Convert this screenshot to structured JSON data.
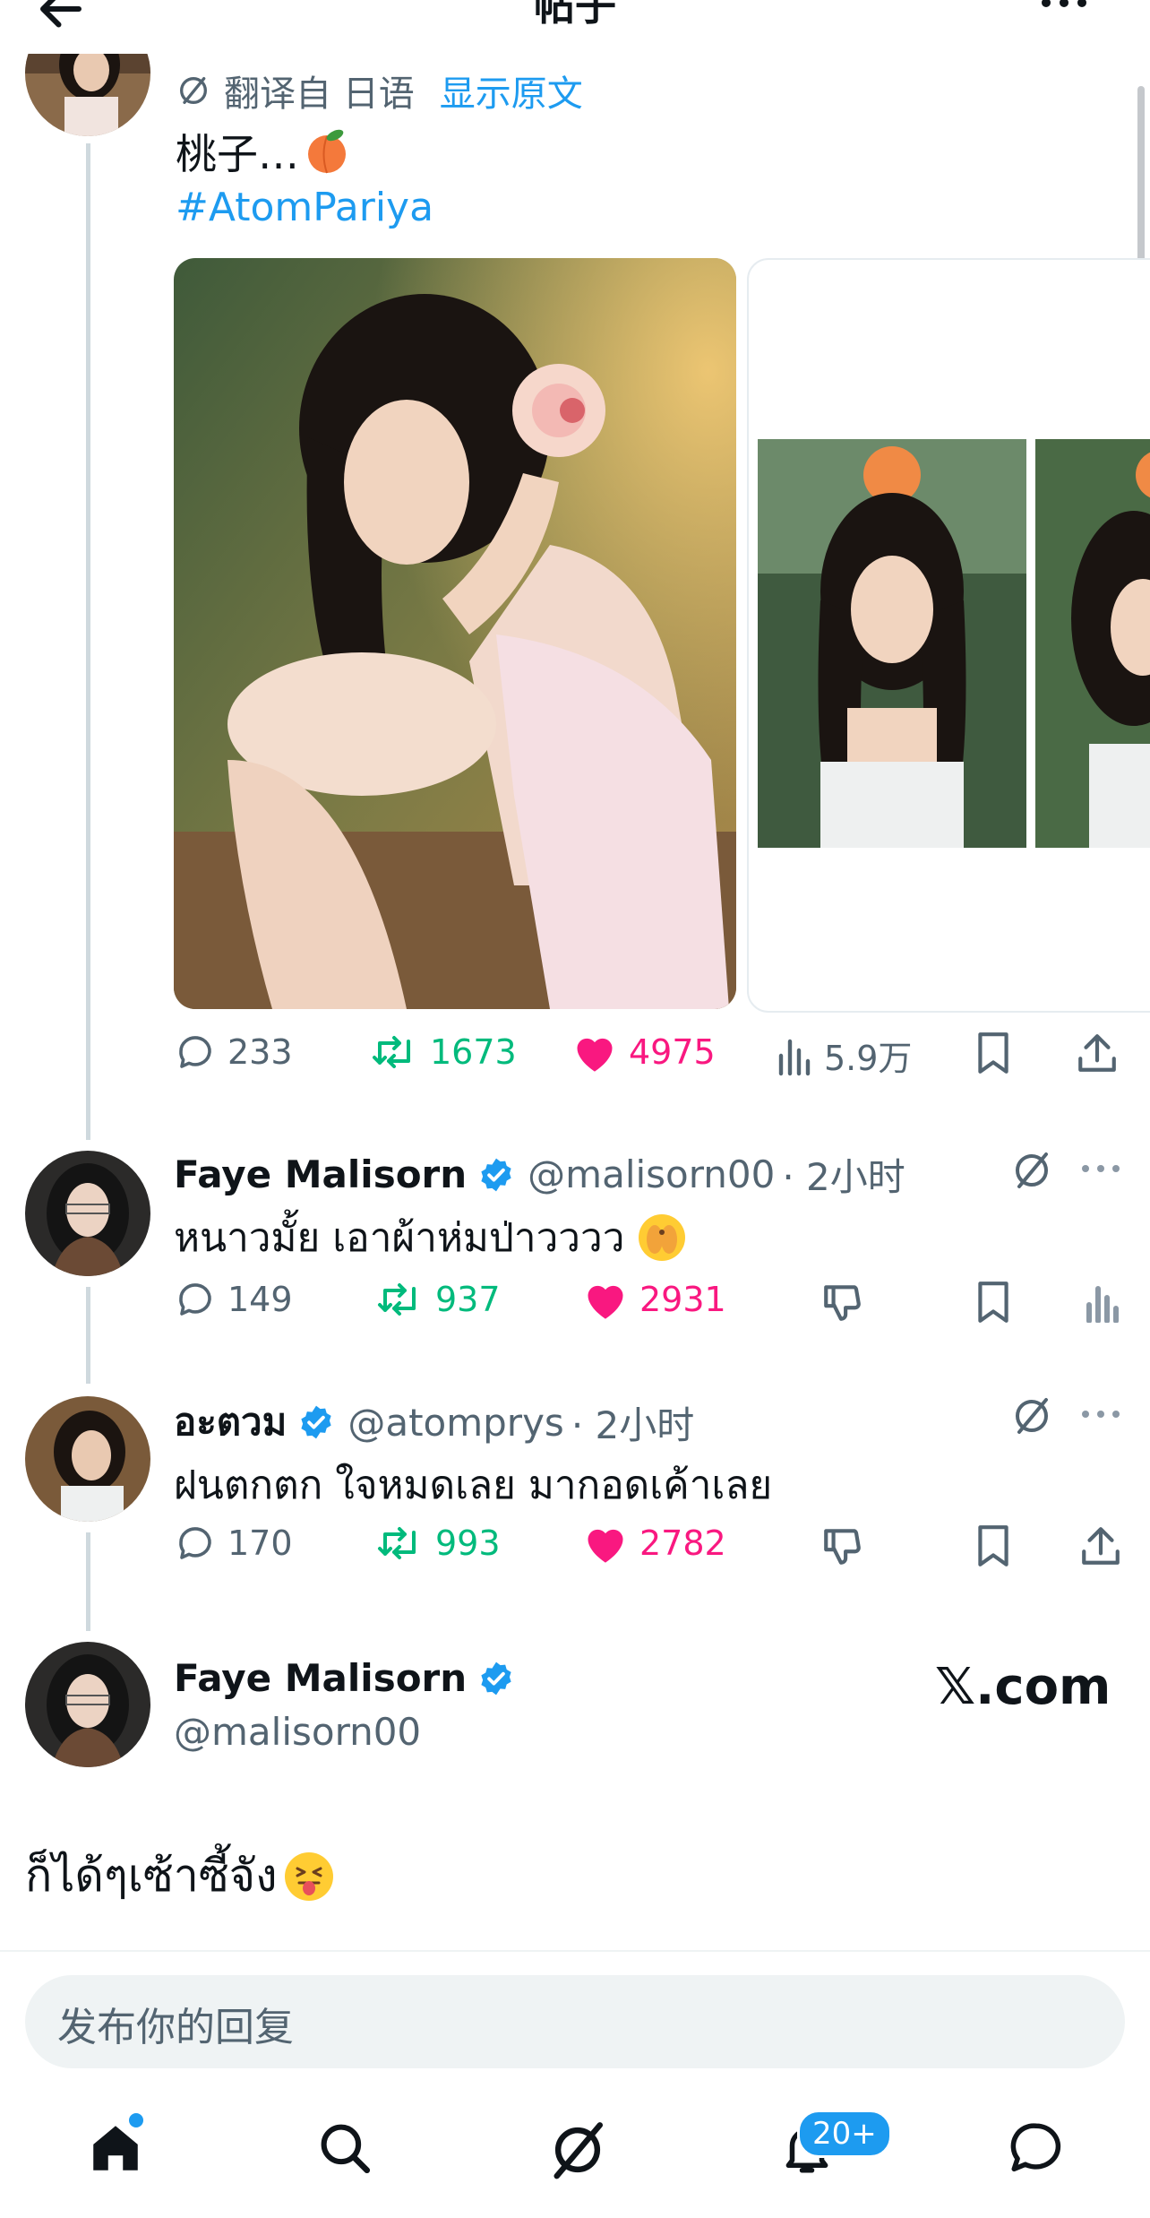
{
  "header": {
    "title": "帖子"
  },
  "main_post": {
    "translate_label": "翻译自 日语",
    "show_original": "显示原文",
    "text": "桃子…",
    "hashtag": "#AtomPariya",
    "stats": {
      "replies": "233",
      "reposts": "1673",
      "likes": "4975",
      "views": "5.9万"
    }
  },
  "replies": [
    {
      "name": "Faye Malisorn",
      "handle": "@malisorn00",
      "time": "· 2小时",
      "text": "หนาวมั้ย เอาผ้าห่มป่าวววว",
      "stats": {
        "replies": "149",
        "reposts": "937",
        "likes": "2931"
      }
    },
    {
      "name": "อะตวม",
      "handle": "@atomprys",
      "time": "· 2小时",
      "text": "ฝนตกตก ใจหมดเลย มากอดเค้าเลย",
      "stats": {
        "replies": "170",
        "reposts": "993",
        "likes": "2782"
      }
    }
  ],
  "focused": {
    "name": "Faye Malisorn",
    "handle": "@malisorn00",
    "watermark": "𝕏.com",
    "text": "ก็ได้ๆเซ้าซี้จัง"
  },
  "reply_input": {
    "placeholder": "发布你的回复"
  },
  "bottom_nav": {
    "notifications_badge": "20+"
  },
  "colors": {
    "accent": "#1d9bf0",
    "repost": "#00ba7c",
    "like": "#f91880",
    "secondary_text": "#536471"
  },
  "icons": [
    "back-arrow-icon",
    "more-icon",
    "translate-icon",
    "reply-icon",
    "repost-icon",
    "like-icon",
    "views-icon",
    "bookmark-icon",
    "share-icon",
    "verified-icon",
    "grok-icon",
    "dislike-icon",
    "home-icon",
    "search-icon",
    "bell-icon",
    "messages-icon"
  ]
}
